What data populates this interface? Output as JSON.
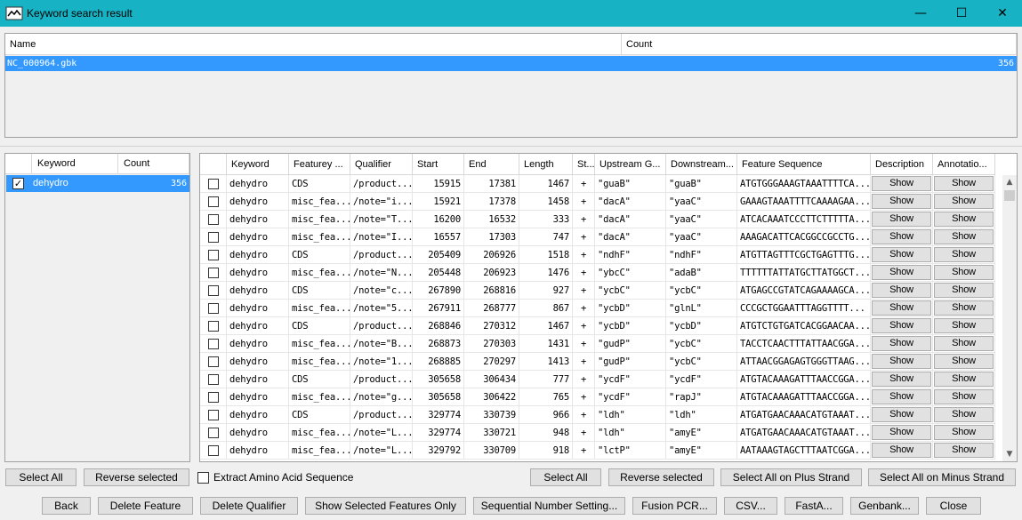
{
  "window": {
    "title": "Keyword search result",
    "minimize": "—",
    "maximize": "☐",
    "close": "✕"
  },
  "files": {
    "headers": [
      "Name",
      "Count"
    ],
    "rows": [
      {
        "name": "NC_000964.gbk",
        "count": "356"
      }
    ]
  },
  "keywords": {
    "headers": [
      "Keyword",
      "Count"
    ],
    "rows": [
      {
        "checked": true,
        "keyword": "dehydro",
        "count": "356"
      }
    ]
  },
  "results": {
    "headers": [
      "",
      "Keyword",
      "Featurey ...",
      "Qualifier",
      "Start",
      "End",
      "Length",
      "St...",
      "Upstream G...",
      "Downstream...",
      "Feature Sequence",
      "Description",
      "Annotatio..."
    ],
    "show_label": "Show",
    "rows": [
      {
        "keyword": "dehydro",
        "feature": "CDS",
        "qualifier": "/product...",
        "start": "15915",
        "end": "17381",
        "length": "1467",
        "strand": "+",
        "up": "\"guaB\"",
        "down": "\"guaB\"",
        "seq": "ATGTGGGAAAGTAAATTTTCA..."
      },
      {
        "keyword": "dehydro",
        "feature": "misc_fea...",
        "qualifier": "/note=\"i...",
        "start": "15921",
        "end": "17378",
        "length": "1458",
        "strand": "+",
        "up": "\"dacA\"",
        "down": "\"yaaC\"",
        "seq": "GAAAGTAAATTTTCAAAAGAA..."
      },
      {
        "keyword": "dehydro",
        "feature": "misc_fea...",
        "qualifier": "/note=\"T...",
        "start": "16200",
        "end": "16532",
        "length": "333",
        "strand": "+",
        "up": "\"dacA\"",
        "down": "\"yaaC\"",
        "seq": "ATCACAAATCCCTTCTTTTTA..."
      },
      {
        "keyword": "dehydro",
        "feature": "misc_fea...",
        "qualifier": "/note=\"I...",
        "start": "16557",
        "end": "17303",
        "length": "747",
        "strand": "+",
        "up": "\"dacA\"",
        "down": "\"yaaC\"",
        "seq": "AAAGACATTCACGGCCGCCTG..."
      },
      {
        "keyword": "dehydro",
        "feature": "CDS",
        "qualifier": "/product...",
        "start": "205409",
        "end": "206926",
        "length": "1518",
        "strand": "+",
        "up": "\"ndhF\"",
        "down": "\"ndhF\"",
        "seq": "ATGTTAGTTTCGCTGAGTTTG..."
      },
      {
        "keyword": "dehydro",
        "feature": "misc_fea...",
        "qualifier": "/note=\"N...",
        "start": "205448",
        "end": "206923",
        "length": "1476",
        "strand": "+",
        "up": "\"ybcC\"",
        "down": "\"adaB\"",
        "seq": "TTTTTTATTATGCTTATGGCT..."
      },
      {
        "keyword": "dehydro",
        "feature": "CDS",
        "qualifier": "/note=\"c...",
        "start": "267890",
        "end": "268816",
        "length": "927",
        "strand": "+",
        "up": "\"ycbC\"",
        "down": "\"ycbC\"",
        "seq": "ATGAGCCGTATCAGAAAAGCA..."
      },
      {
        "keyword": "dehydro",
        "feature": "misc_fea...",
        "qualifier": "/note=\"5...",
        "start": "267911",
        "end": "268777",
        "length": "867",
        "strand": "+",
        "up": "\"ycbD\"",
        "down": "\"glnL\"",
        "seq": "CCCGCTGGAATTTAGGTTTT..."
      },
      {
        "keyword": "dehydro",
        "feature": "CDS",
        "qualifier": "/product...",
        "start": "268846",
        "end": "270312",
        "length": "1467",
        "strand": "+",
        "up": "\"ycbD\"",
        "down": "\"ycbD\"",
        "seq": "ATGTCTGTGATCACGGAACAA..."
      },
      {
        "keyword": "dehydro",
        "feature": "misc_fea...",
        "qualifier": "/note=\"B...",
        "start": "268873",
        "end": "270303",
        "length": "1431",
        "strand": "+",
        "up": "\"gudP\"",
        "down": "\"ycbC\"",
        "seq": "TACCTCAACTTTATTAACGGA..."
      },
      {
        "keyword": "dehydro",
        "feature": "misc_fea...",
        "qualifier": "/note=\"1...",
        "start": "268885",
        "end": "270297",
        "length": "1413",
        "strand": "+",
        "up": "\"gudP\"",
        "down": "\"ycbC\"",
        "seq": "ATTAACGGAGAGTGGGTTAAG..."
      },
      {
        "keyword": "dehydro",
        "feature": "CDS",
        "qualifier": "/product...",
        "start": "305658",
        "end": "306434",
        "length": "777",
        "strand": "+",
        "up": "\"ycdF\"",
        "down": "\"ycdF\"",
        "seq": "ATGTACAAAGATTTAACCGGA..."
      },
      {
        "keyword": "dehydro",
        "feature": "misc_fea...",
        "qualifier": "/note=\"g...",
        "start": "305658",
        "end": "306422",
        "length": "765",
        "strand": "+",
        "up": "\"ycdF\"",
        "down": "\"rapJ\"",
        "seq": "ATGTACAAAGATTTAACCGGA..."
      },
      {
        "keyword": "dehydro",
        "feature": "CDS",
        "qualifier": "/product...",
        "start": "329774",
        "end": "330739",
        "length": "966",
        "strand": "+",
        "up": "\"ldh\"",
        "down": "\"ldh\"",
        "seq": "ATGATGAACAAACATGTAAAT..."
      },
      {
        "keyword": "dehydro",
        "feature": "misc_fea...",
        "qualifier": "/note=\"L...",
        "start": "329774",
        "end": "330721",
        "length": "948",
        "strand": "+",
        "up": "\"ldh\"",
        "down": "\"amyE\"",
        "seq": "ATGATGAACAAACATGTAAAT..."
      },
      {
        "keyword": "dehydro",
        "feature": "misc_fea...",
        "qualifier": "/note=\"L...",
        "start": "329792",
        "end": "330709",
        "length": "918",
        "strand": "+",
        "up": "\"lctP\"",
        "down": "\"amyE\"",
        "seq": "AATAAAGTAGCTTTAATCGGA..."
      }
    ]
  },
  "left_buttons": {
    "select_all": "Select All",
    "reverse": "Reverse selected"
  },
  "extract_label": "Extract Amino Acid Sequence",
  "right_buttons": {
    "select_all": "Select All",
    "reverse": "Reverse selected",
    "plus": "Select All on Plus Strand",
    "minus": "Select All on Minus Strand"
  },
  "bottom_buttons": [
    "Back",
    "Delete Feature",
    "Delete Qualifier",
    "Show Selected Features Only",
    "Sequential Number Setting...",
    "Fusion PCR...",
    "CSV...",
    "FastA...",
    "Genbank...",
    "Close"
  ],
  "scroll": {
    "up": "▲",
    "down": "▼"
  }
}
